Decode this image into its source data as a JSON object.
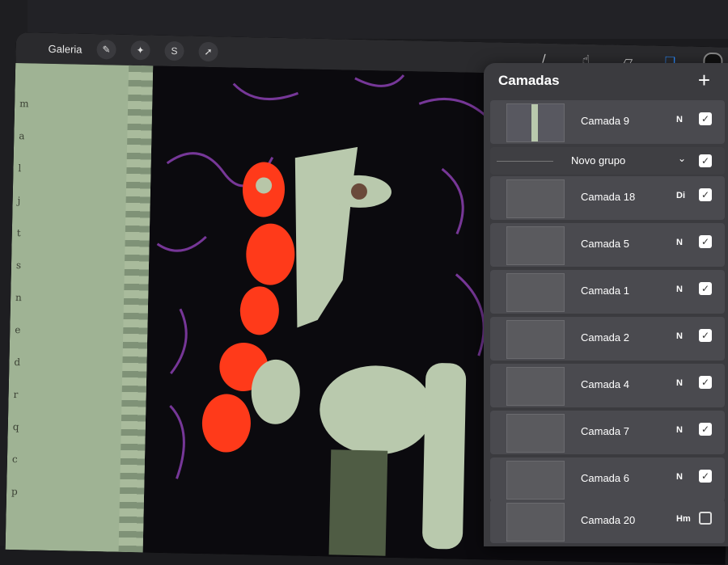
{
  "toolbar": {
    "gallery_label": "Galeria",
    "left_icons": [
      "wrench-icon",
      "magic-wand-icon",
      "selection-icon",
      "transform-arrow-icon"
    ],
    "right_icons": [
      "brush-icon",
      "smudge-icon",
      "eraser-icon",
      "layers-icon"
    ],
    "layers_active_color": "#2b8bff"
  },
  "paper": {
    "letters": [
      "m",
      "a",
      "l",
      "j",
      "t",
      "s",
      "n",
      "e",
      "d",
      "r",
      "q",
      "c",
      "p"
    ]
  },
  "layers": {
    "title": "Camadas",
    "add_label": "+",
    "group": {
      "name": "Novo grupo",
      "visible": true
    },
    "items": [
      {
        "name": "Camada 9",
        "mode": "N",
        "visible": true
      },
      {
        "name": "Camada 18",
        "mode": "Di",
        "visible": true
      },
      {
        "name": "Camada 5",
        "mode": "N",
        "visible": true
      },
      {
        "name": "Camada 1",
        "mode": "N",
        "visible": true
      },
      {
        "name": "Camada 2",
        "mode": "N",
        "visible": true
      },
      {
        "name": "Camada 4",
        "mode": "N",
        "visible": true
      },
      {
        "name": "Camada 7",
        "mode": "N",
        "visible": true
      },
      {
        "name": "Camada 6",
        "mode": "N",
        "visible": true
      },
      {
        "name": "Camada 20",
        "mode": "Hm",
        "visible": false
      }
    ]
  }
}
